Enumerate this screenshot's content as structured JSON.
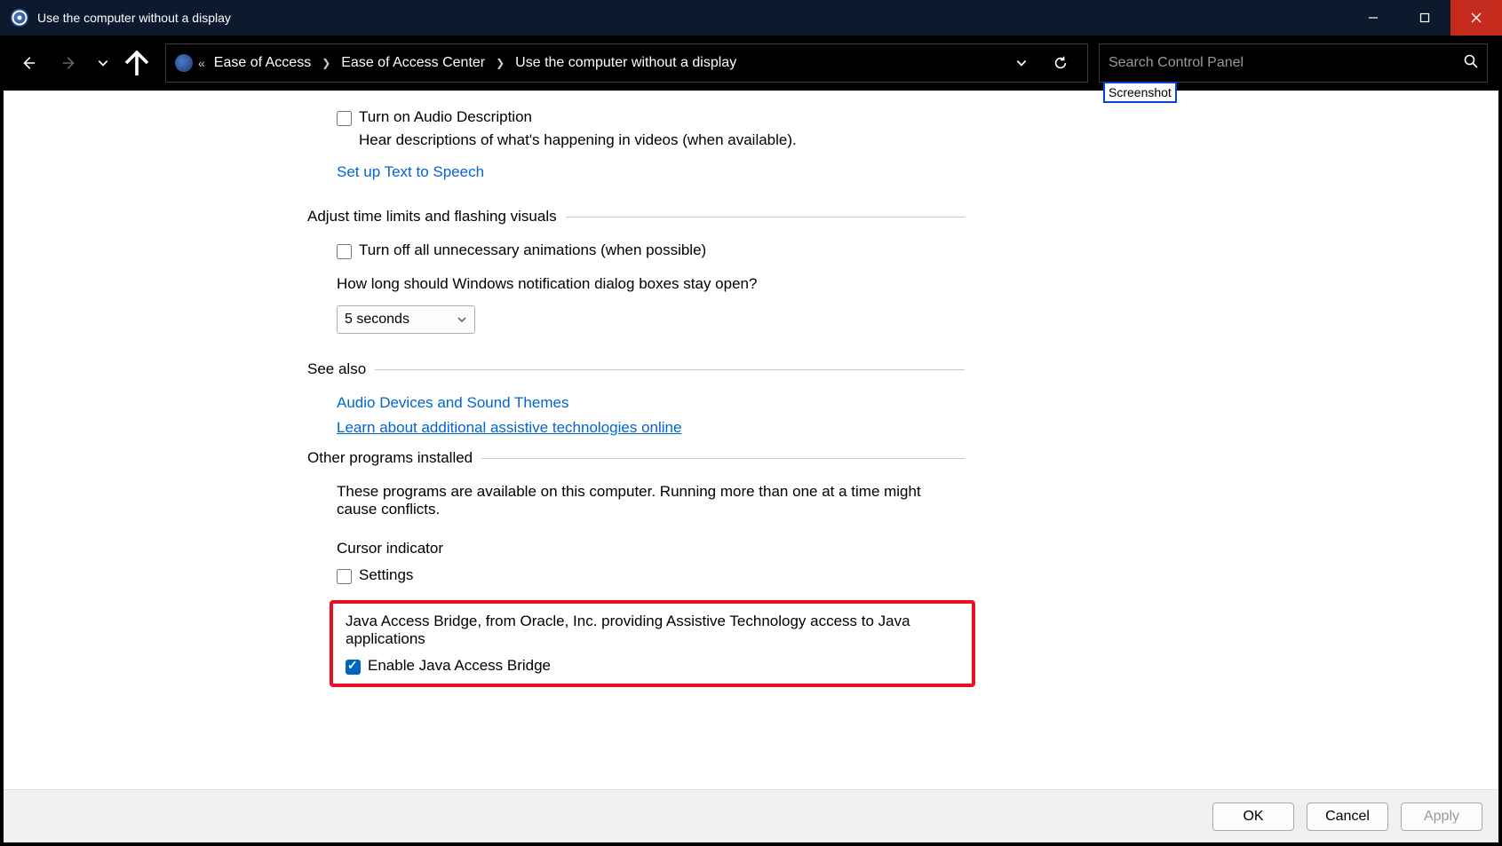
{
  "titlebar": {
    "title": "Use the computer without a display"
  },
  "breadcrumb": {
    "items": [
      "Ease of Access",
      "Ease of Access Center",
      "Use the computer without a display"
    ]
  },
  "search": {
    "placeholder": "Search Control Panel",
    "tooltip": "Screenshot"
  },
  "sections": {
    "audio_desc": {
      "checkbox_label": "Turn on Audio Description",
      "desc": "Hear descriptions of what's happening in videos (when available).",
      "link": "Set up Text to Speech"
    },
    "time_limits": {
      "header": "Adjust time limits and flashing visuals",
      "checkbox_label": "Turn off all unnecessary animations (when possible)",
      "question": "How long should Windows notification dialog boxes stay open?",
      "select_value": "5 seconds"
    },
    "see_also": {
      "header": "See also",
      "link1": "Audio Devices and Sound Themes",
      "link2": "Learn about additional assistive technologies online"
    },
    "other_programs": {
      "header": "Other programs installed",
      "desc": "These programs are available on this computer. Running more than one at a time might cause conflicts.",
      "cursor_label": "Cursor indicator",
      "settings_label": "Settings",
      "java_desc": "Java Access Bridge, from Oracle, Inc. providing Assistive Technology access to Java applications",
      "java_checkbox": "Enable Java Access Bridge"
    }
  },
  "footer": {
    "ok": "OK",
    "cancel": "Cancel",
    "apply": "Apply"
  }
}
